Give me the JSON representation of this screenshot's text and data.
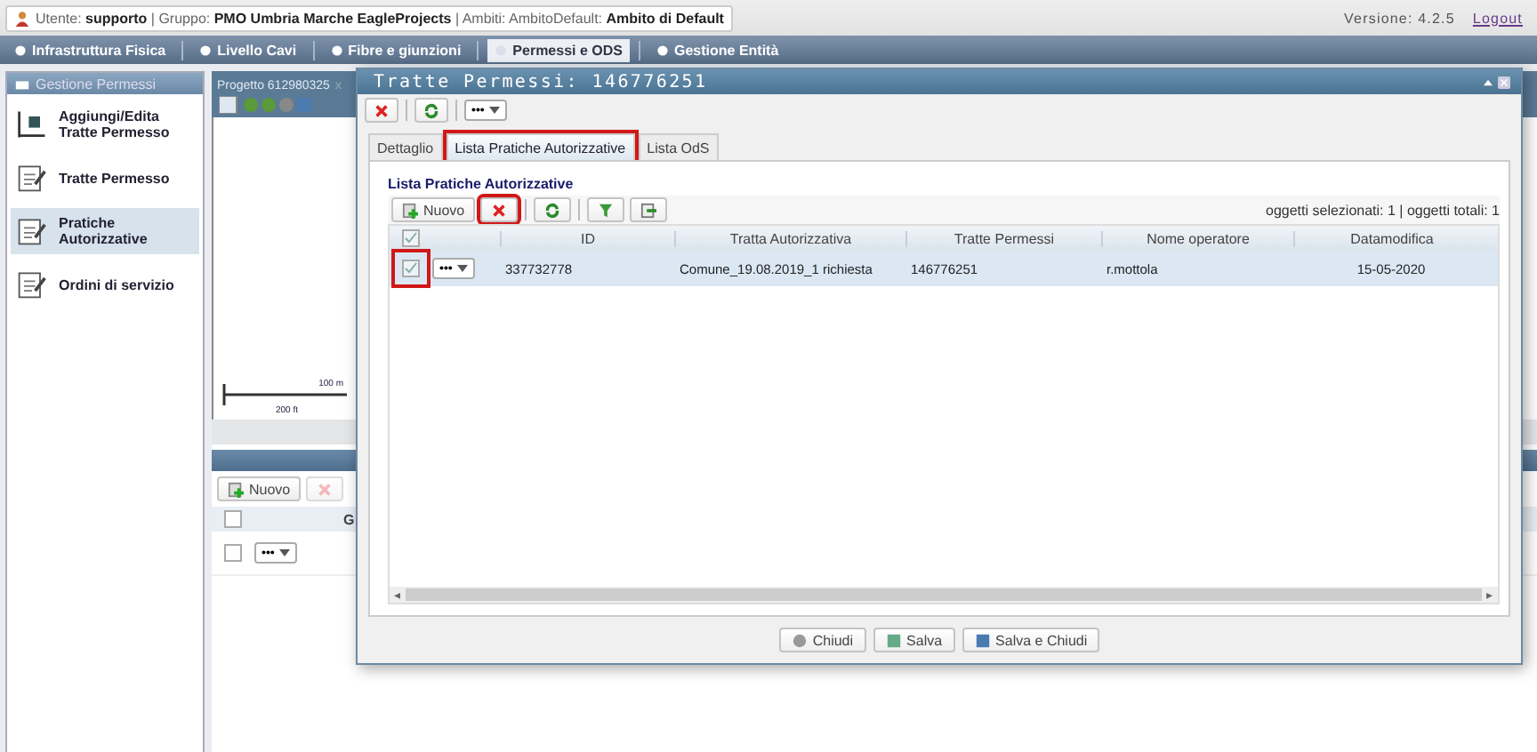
{
  "user_bar": {
    "info": "Utente: **supporto** | Gruppo: **PMO Umbria Marche EagleProjects** | Ambiti: AmbitoDefault: **Ambito di Default**",
    "version": "Versione: 4.2.5",
    "logout": "Logout"
  },
  "nav": [
    {
      "label": "Infrastruttura Fisica",
      "selected": false
    },
    {
      "label": "Livello Cavi",
      "selected": false
    },
    {
      "label": "Fibre e giunzioni",
      "selected": false
    },
    {
      "label": "Permessi e ODS",
      "selected": true
    },
    {
      "label": "Gestione Entità",
      "selected": false
    }
  ],
  "sidebar": {
    "title": "Gestione Permessi",
    "items": [
      {
        "label": "Aggiungi/Edita Tratte Permesso",
        "kind": "route",
        "selected": false
      },
      {
        "label": "Tratte Permesso",
        "kind": "edit",
        "selected": false
      },
      {
        "label": "Pratiche Autorizzative",
        "kind": "edit",
        "selected": true
      },
      {
        "label": "Ordini di servizio",
        "kind": "edit",
        "selected": false
      }
    ]
  },
  "map": {
    "tab": "Progetto 612980325",
    "tab_close": "x",
    "scale_metric": "100 m",
    "scale_imperial": "200 ft"
  },
  "lower_panel": {
    "new_button": "Nuovo",
    "column_1": "G",
    "header_checked": false,
    "rows": [
      {
        "checked": false,
        "menu": "•••"
      }
    ]
  },
  "dialog": {
    "title": "Tratte Permessi: 146776251",
    "toolbar_menu": "•••",
    "tabs": [
      {
        "label": "Dettaglio",
        "selected": false,
        "highlighted": false
      },
      {
        "label": "Lista Pratiche Autorizzative",
        "selected": true,
        "highlighted": true
      },
      {
        "label": "Lista OdS",
        "selected": false,
        "highlighted": false
      }
    ],
    "section_title": "Lista Pratiche Autorizzative",
    "new_button": "Nuovo",
    "delete_highlighted": true,
    "selection_info": "oggetti selezionati: 1 | oggetti totali: 1",
    "columns": [
      "ID",
      "Tratta Autorizzativa",
      "Tratte Permessi",
      "Nome operatore",
      "Datamodifica"
    ],
    "header_checked": true,
    "rows": [
      {
        "checked": true,
        "highlighted": true,
        "selected": true,
        "menu": "•••",
        "cells": [
          "337732778",
          "Comune_19.08.2019_1 richiesta",
          "146776251",
          "r.mottola",
          "15-05-2020"
        ]
      }
    ],
    "scroll_left": "◂",
    "scroll_right": "▸",
    "footer_buttons": [
      {
        "label": "Chiudi",
        "kind": "close"
      },
      {
        "label": "Salva",
        "kind": "save"
      },
      {
        "label": "Salva e Chiudi",
        "kind": "save-close"
      }
    ]
  }
}
